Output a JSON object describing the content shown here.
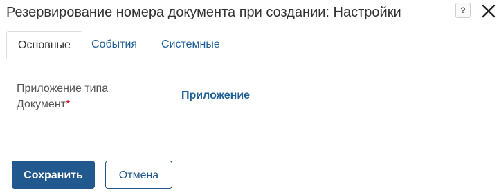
{
  "dialog": {
    "title": "Резервирование номера документа при создании: Настройки",
    "help_icon": "question-mark-icon",
    "help_label": "?",
    "close_icon": "close-icon"
  },
  "tabs": [
    {
      "label": "Основные",
      "active": true
    },
    {
      "label": "События",
      "active": false
    },
    {
      "label": "Системные",
      "active": false
    }
  ],
  "form": {
    "field_label_line1": "Приложение типа",
    "field_label_line2": "Документ",
    "required_mark": "*",
    "field_value": "Приложение"
  },
  "footer": {
    "save_label": "Сохранить",
    "cancel_label": "Отмена"
  },
  "colors": {
    "accent": "#21598f",
    "link": "#1f5f98",
    "required": "#d0021b"
  }
}
